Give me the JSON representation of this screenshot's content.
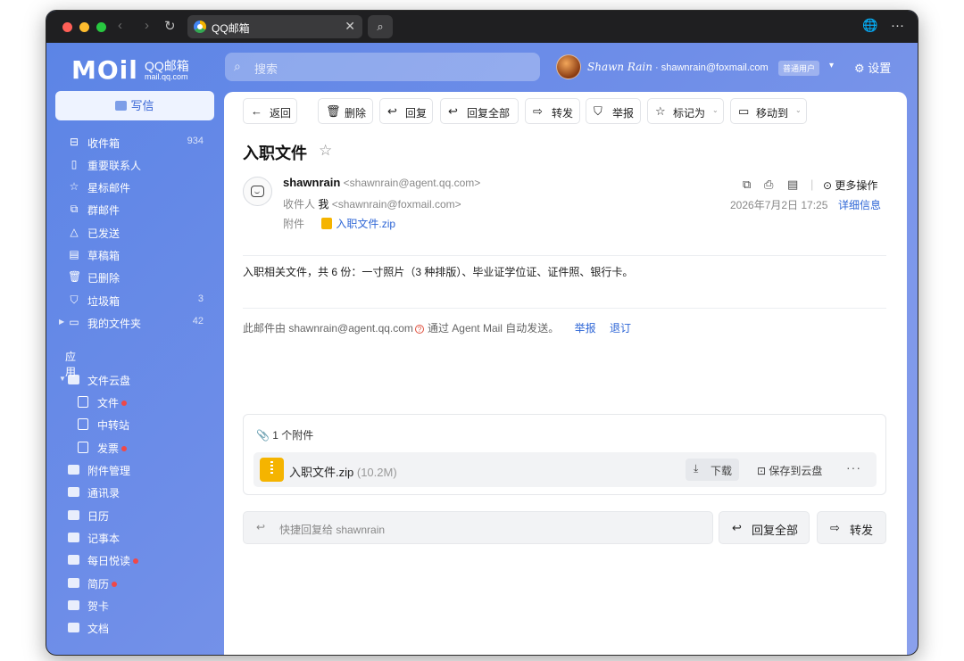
{
  "browser": {
    "tab_title": "QQ邮箱",
    "tab_close": "✕",
    "search_glyph": "⌕",
    "globe_glyph": "🌐",
    "more_glyph": "···",
    "back_glyph": "‹",
    "forward_glyph": "›",
    "reload_glyph": "↻"
  },
  "header": {
    "logo_big": "MOil",
    "logo_qq": "QQ邮箱",
    "logo_domain": "mail.qq.com",
    "search_placeholder": "搜索",
    "user_name": "Shawn Rain",
    "user_email": " · shawnrain@foxmail.com",
    "user_badge": "普通用户",
    "settings_label": "设置"
  },
  "sidebar": {
    "compose_label": "写信",
    "items": [
      {
        "label": "收件箱",
        "count": "934",
        "icon": "inbox-icon"
      },
      {
        "label": "重要联系人",
        "count": "",
        "icon": "bookmark-icon"
      },
      {
        "label": "星标邮件",
        "count": "",
        "icon": "star-icon"
      },
      {
        "label": "群邮件",
        "count": "",
        "icon": "group-icon"
      },
      {
        "label": "已发送",
        "count": "",
        "icon": "send-icon"
      },
      {
        "label": "草稿箱",
        "count": "",
        "icon": "draft-icon"
      },
      {
        "label": "已删除",
        "count": "",
        "icon": "trash-icon"
      },
      {
        "label": "垃圾箱",
        "count": "3",
        "icon": "shield-icon"
      },
      {
        "label": "我的文件夹",
        "count": "42",
        "icon": "folder-icon"
      }
    ],
    "apps_title": "应用",
    "apps": [
      {
        "label": "文件云盘",
        "dot": false
      },
      {
        "label": "文件",
        "dot": true
      },
      {
        "label": "中转站",
        "dot": false
      },
      {
        "label": "发票",
        "dot": true
      },
      {
        "label": "附件管理",
        "dot": false
      },
      {
        "label": "通讯录",
        "dot": false
      },
      {
        "label": "日历",
        "dot": false
      },
      {
        "label": "记事本",
        "dot": false
      },
      {
        "label": "每日悦读",
        "dot": true
      },
      {
        "label": "简历",
        "dot": true
      },
      {
        "label": "贺卡",
        "dot": false
      },
      {
        "label": "文档",
        "dot": false
      }
    ]
  },
  "toolbar": {
    "back": "返回",
    "delete": "删除",
    "reply": "回复",
    "reply_all": "回复全部",
    "forward": "转发",
    "report": "举报",
    "mark_as": "标记为",
    "move_to": "移动到"
  },
  "mail": {
    "subject": "入职文件",
    "sender_name": "shawnrain",
    "sender_addr": "<shawnrain@agent.qq.com>",
    "to_label": "收件人",
    "to_name": "我",
    "to_addr": "<shawnrain@foxmail.com>",
    "attach_label": "附件",
    "attach_name": "入职文件.zip",
    "more_ops": "更多操作",
    "date": "2026年7月2日 17:25",
    "detail": "详细信息",
    "body": "入职相关文件，共 6 份：一寸照片（3 种排版）、毕业证学位证、证件照、银行卡。",
    "footer_prefix": "此邮件由  shawnrain@agent.qq.com",
    "footer_suffix": "通过 Agent Mail 自动发送。",
    "footer_report": "举报",
    "footer_unsub": "退订"
  },
  "attachments": {
    "title": "1 个附件",
    "file_name": "入职文件.zip",
    "file_size": "(10.2M)",
    "download": "下载",
    "save_cloud": "保存到云盘",
    "more": "···"
  },
  "quick_reply": {
    "placeholder": "快捷回复给 shawnrain",
    "reply_all": "回复全部",
    "forward": "转发"
  },
  "colors": {
    "accent": "#2e66d6",
    "sidebar_gradient_start": "#5b84e6",
    "sidebar_gradient_end": "#8aa0ec",
    "zip": "#f5b400",
    "badge_dot": "#f04848"
  }
}
